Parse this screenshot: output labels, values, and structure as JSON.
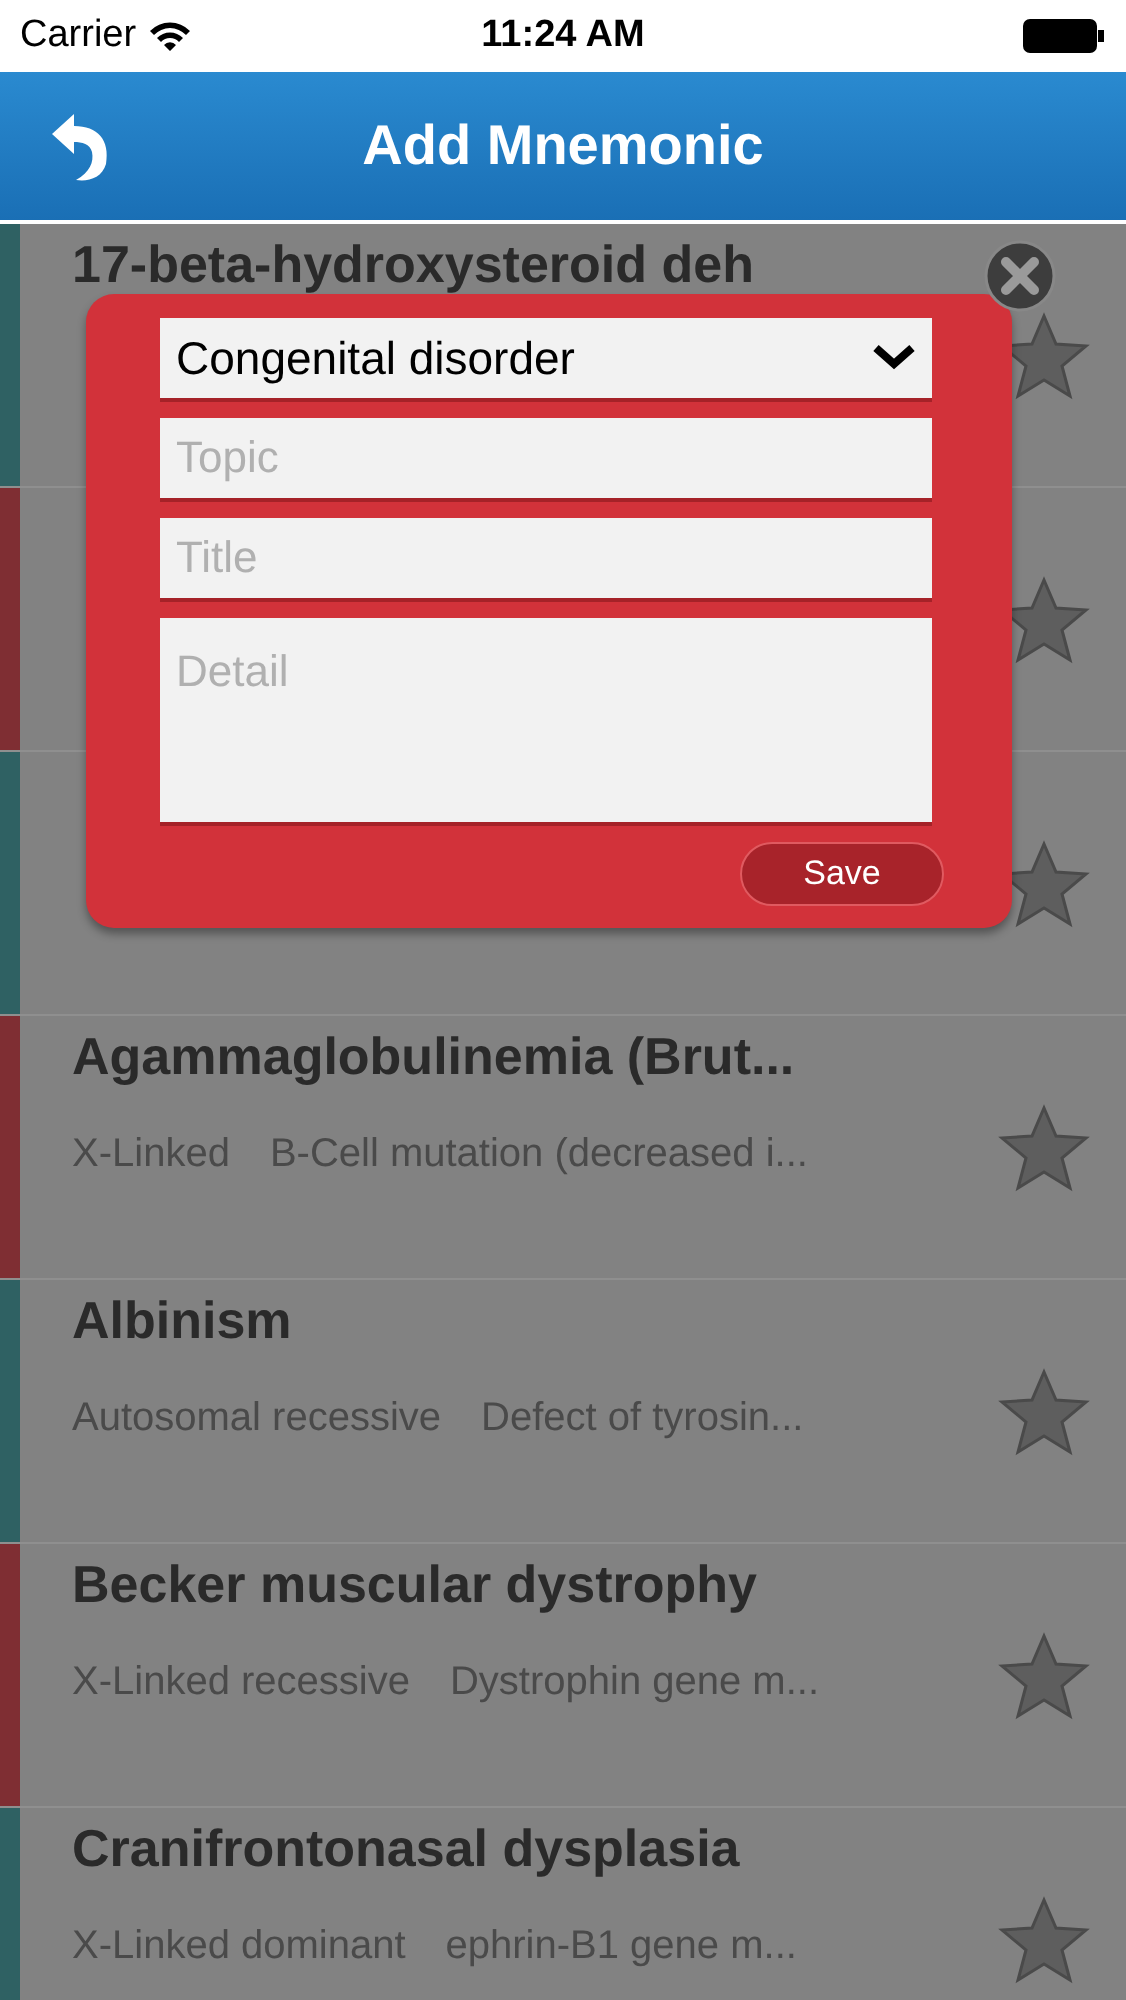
{
  "status_bar": {
    "carrier": "Carrier",
    "time": "11:24 AM"
  },
  "nav_bar": {
    "title": "Add Mnemonic"
  },
  "rows": [
    {
      "title": "17-beta-hydroxysteroid deh",
      "color": "#2f6163"
    },
    {
      "color": "#7f2e33"
    },
    {
      "color": "#2f6163"
    },
    {
      "title": "Agammaglobulinemia (Brut...",
      "inheritance": "X-Linked",
      "detail": "B-Cell mutation (decreased i...",
      "color": "#7f2e33"
    },
    {
      "title": "Albinism",
      "inheritance": "Autosomal recessive",
      "detail": "Defect of tyrosin...",
      "color": "#2f6163"
    },
    {
      "title": "Becker muscular dystrophy",
      "inheritance": "X-Linked recessive",
      "detail": "Dystrophin gene m...",
      "color": "#7f2e33"
    },
    {
      "title": "Cranifrontonasal dysplasia",
      "inheritance": "X-Linked dominant",
      "detail": "ephrin-B1 gene m...",
      "color": "#2f6163"
    }
  ],
  "dialog": {
    "category": "Congenital disorder",
    "topic_placeholder": "Topic",
    "title_placeholder": "Title",
    "detail_placeholder": "Detail",
    "save": "Save"
  }
}
